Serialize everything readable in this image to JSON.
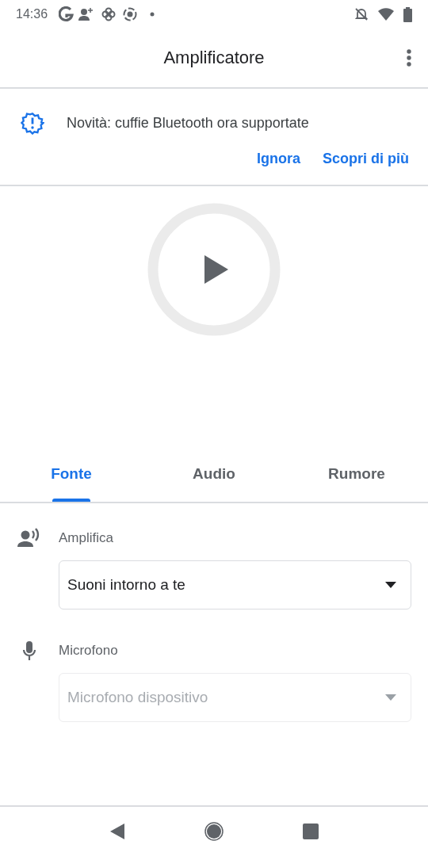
{
  "status_bar": {
    "time": "14:36"
  },
  "app_bar": {
    "title": "Amplificatore"
  },
  "banner": {
    "message": "Novità: cuffie Bluetooth ora supportate",
    "actions": [
      "Ignora",
      "Scopri di più"
    ]
  },
  "tabs": [
    {
      "label": "Fonte",
      "selected": true
    },
    {
      "label": "Audio",
      "selected": false
    },
    {
      "label": "Rumore",
      "selected": false
    }
  ],
  "settings": [
    {
      "kind": "speaker",
      "label": "Amplifica",
      "dropdown": {
        "value": "Suoni intorno a te",
        "disabled": false
      }
    },
    {
      "kind": "mic",
      "label": "Microfono",
      "dropdown": {
        "value": "Microfono dispositivo",
        "disabled": true
      }
    }
  ]
}
